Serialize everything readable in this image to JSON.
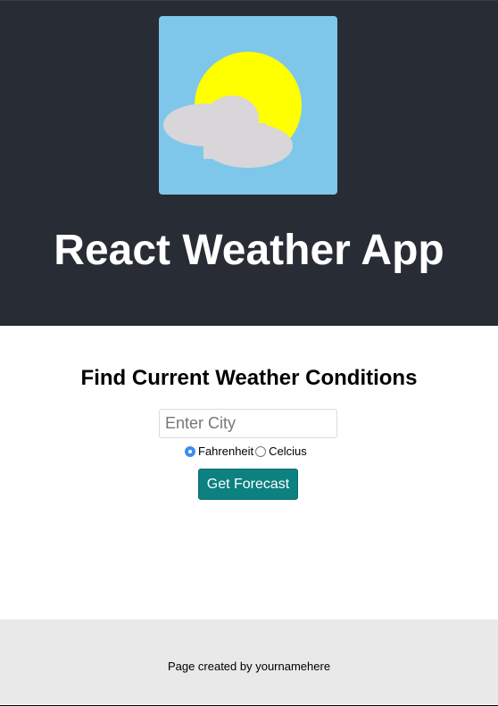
{
  "header": {
    "title": "React Weather App",
    "logo_icon": "sun-behind-cloud-icon",
    "colors": {
      "background": "#282c34",
      "sky": "#7fc7ea",
      "sun": "#ffff00",
      "cloud": "#d8d6d8"
    }
  },
  "main": {
    "heading": "Find Current Weather Conditions",
    "city_input": {
      "placeholder": "Enter City",
      "value": ""
    },
    "units": [
      {
        "label": "Fahrenheit",
        "checked": true
      },
      {
        "label": "Celcius",
        "checked": false
      }
    ],
    "submit_label": "Get Forecast",
    "colors": {
      "button": "#0d8080",
      "radio_checked": "#3b8df0"
    }
  },
  "footer": {
    "text": "Page created by yournamehere",
    "colors": {
      "background": "#e9e9e9"
    }
  }
}
